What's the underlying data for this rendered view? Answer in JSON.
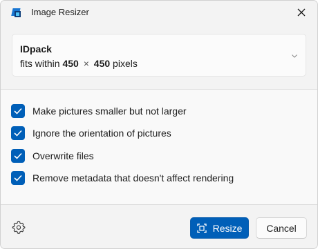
{
  "window": {
    "title": "Image Resizer",
    "app_icon": "image-resizer-icon",
    "close_icon": "close-icon"
  },
  "preset": {
    "name": "IDpack",
    "desc_prefix": "fits within",
    "width": "450",
    "times": "×",
    "height": "450",
    "unit": "pixels",
    "chevron_icon": "chevron-down-icon"
  },
  "options": [
    {
      "label": "Make pictures smaller but not larger",
      "checked": true
    },
    {
      "label": "Ignore the orientation of pictures",
      "checked": true
    },
    {
      "label": "Overwrite files",
      "checked": true
    },
    {
      "label": "Remove metadata that doesn't affect rendering",
      "checked": true
    }
  ],
  "footer": {
    "settings_icon": "gear-icon",
    "resize_label": "Resize",
    "resize_icon": "resize-icon",
    "cancel_label": "Cancel"
  },
  "colors": {
    "accent": "#005fb8",
    "window_bg": "#f3f3f3",
    "options_bg": "#f9f9f9"
  }
}
